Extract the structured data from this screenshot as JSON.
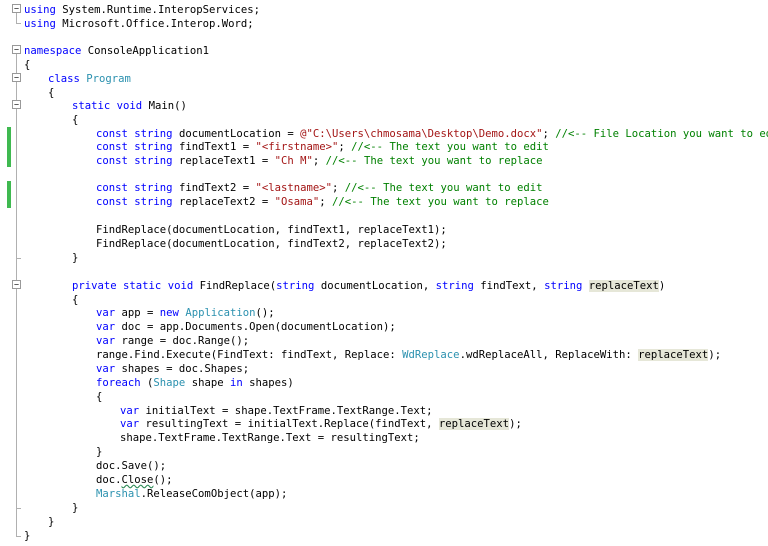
{
  "colors": {
    "keyword": "#0000ff",
    "type": "#2b91af",
    "string": "#a31515",
    "comment": "#008000",
    "highlight": "#e6e7d8",
    "change_bar": "#3fb950"
  },
  "code": {
    "using1": {
      "kw": "using",
      "rest": " System.Runtime.InteropServices;"
    },
    "using2": {
      "kw": "using",
      "rest": " Microsoft.Office.Interop.Word;"
    },
    "ns": {
      "kw": "namespace",
      "rest": " ConsoleApplication1"
    },
    "brace_open": "{",
    "brace_close": "}",
    "class_line": {
      "kw": "class",
      "type": "Program"
    },
    "main_sig": {
      "kw1": "static",
      "kw2": "void",
      "rest": " Main()"
    },
    "c1": {
      "kw": "const",
      "kw2": "string",
      "name": " documentLocation = ",
      "str": "@\"C:\\Users\\chmosama\\Desktop\\Demo.docx\"",
      "tail": "; ",
      "comment": "//<-- File Location you want to edit"
    },
    "c2": {
      "kw": "const",
      "kw2": "string",
      "name": " findText1 = ",
      "str": "\"<firstname>\"",
      "tail": "; ",
      "comment": "//<-- The text you want to edit"
    },
    "c3": {
      "kw": "const",
      "kw2": "string",
      "name": " replaceText1 = ",
      "str": "\"Ch M\"",
      "tail": "; ",
      "comment": "//<-- The text you want to replace"
    },
    "c4": {
      "kw": "const",
      "kw2": "string",
      "name": " findText2 = ",
      "str": "\"<lastname>\"",
      "tail": "; ",
      "comment": "//<-- The text you want to edit"
    },
    "c5": {
      "kw": "const",
      "kw2": "string",
      "name": " replaceText2 = ",
      "str": "\"Osama\"",
      "tail": "; ",
      "comment": "//<-- The text you want to replace"
    },
    "call1": "FindReplace(documentLocation, findText1, replaceText1);",
    "call2": "FindReplace(documentLocation, findText2, replaceText2);",
    "fr_sig": {
      "kw1": "private",
      "kw2": "static",
      "kw3": "void",
      "name": " FindReplace(",
      "kw4": "string",
      "p1": " documentLocation, ",
      "kw5": "string",
      "p2": " findText, ",
      "kw6": "string",
      "p3": "replaceText",
      "end": ")"
    },
    "v_app": {
      "kw": "var",
      "mid": " app = ",
      "kw2": "new",
      "type": "Application",
      "end": "();"
    },
    "v_doc": {
      "kw": "var",
      "rest": " doc = app.Documents.Open(documentLocation);"
    },
    "v_range": {
      "kw": "var",
      "rest": " range = doc.Range();"
    },
    "exec": {
      "pre": "range.Find.Execute(FindText: findText, Replace: ",
      "type": "WdReplace",
      "mid": ".wdReplaceAll, ReplaceWith: ",
      "hl": "replaceText",
      "end": ");"
    },
    "v_shapes": {
      "kw": "var",
      "rest": " shapes = doc.Shapes;"
    },
    "foreach": {
      "kw": "foreach",
      "p": " (",
      "type": "Shape",
      "mid": " shape ",
      "kw2": "in",
      "end": " shapes)"
    },
    "v_initial": {
      "kw": "var",
      "rest": " initialText = shape.TextFrame.TextRange.Text;"
    },
    "v_result": {
      "kw": "var",
      "pre": " resultingText = initialText.Replace(findText, ",
      "hl": "replaceText",
      "end": ");"
    },
    "assign": "shape.TextFrame.TextRange.Text = resultingText;",
    "save": "doc.Save();",
    "close": {
      "pre": "doc.",
      "squig": "Close",
      "end": "();"
    },
    "marshal": {
      "type": "Marshal",
      "rest": ".ReleaseComObject(app);"
    }
  }
}
